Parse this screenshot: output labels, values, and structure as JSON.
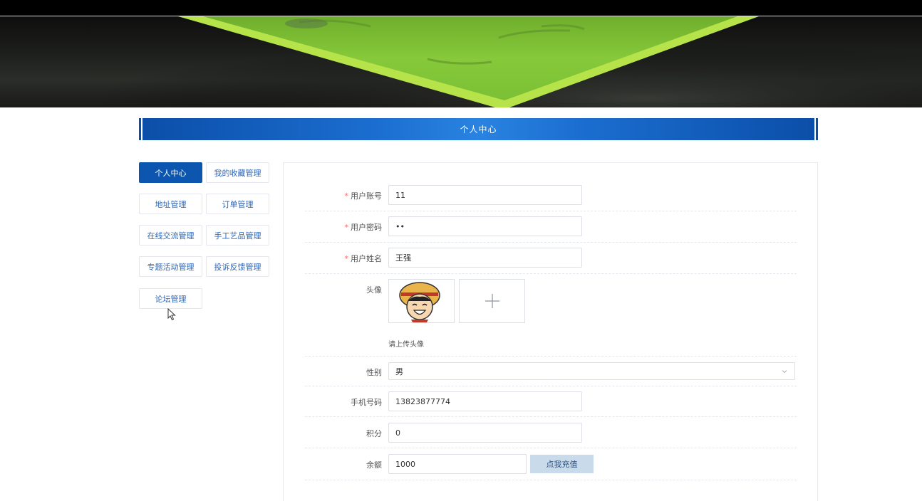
{
  "title_bar": {
    "title": "个人中心"
  },
  "banner": {
    "dots": 3,
    "active_dot": 0
  },
  "side_menu": [
    {
      "label": "个人中心",
      "active": true
    },
    {
      "label": "我的收藏管理",
      "active": false
    },
    {
      "label": "地址管理",
      "active": false
    },
    {
      "label": "订单管理",
      "active": false
    },
    {
      "label": "在线交流管理",
      "active": false
    },
    {
      "label": "手工艺品管理",
      "active": false
    },
    {
      "label": "专题活动管理",
      "active": false
    },
    {
      "label": "投诉反馈管理",
      "active": false
    },
    {
      "label": "论坛管理",
      "active": false
    }
  ],
  "form": {
    "account": {
      "label": "用户账号",
      "required": true,
      "value": "11"
    },
    "password": {
      "label": "用户密码",
      "required": true,
      "value": "••"
    },
    "name": {
      "label": "用户姓名",
      "required": true,
      "value": "王强"
    },
    "avatar": {
      "label": "头像",
      "hint": "请上传头像",
      "add_symbol": "+"
    },
    "gender": {
      "label": "性别",
      "value": "男"
    },
    "phone": {
      "label": "手机号码",
      "value": "13823877774"
    },
    "points": {
      "label": "积分",
      "value": "0"
    },
    "balance": {
      "label": "余额",
      "value": "1000",
      "recharge_label": "点我充值"
    }
  },
  "colors": {
    "primary": "#0d56b0",
    "required": "#f56c6c",
    "recharge_bg": "#c9daeb"
  }
}
